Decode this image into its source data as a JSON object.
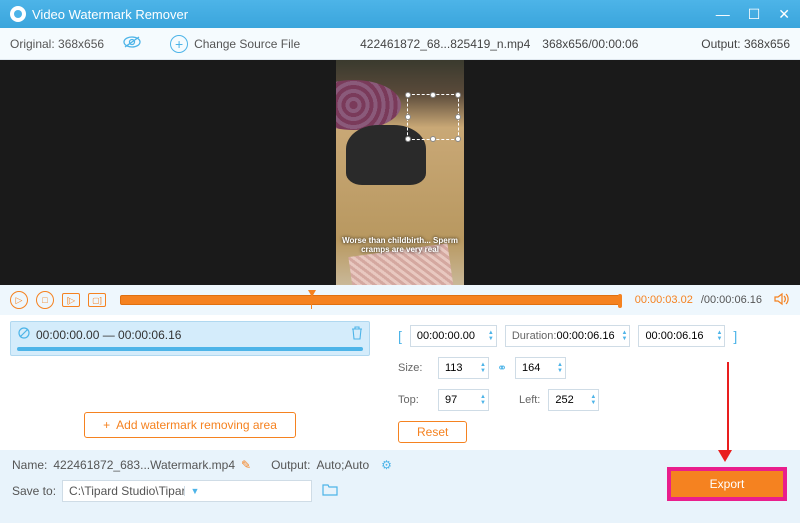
{
  "title": "Video Watermark Remover",
  "subbar": {
    "original": "Original: 368x656",
    "change_source": "Change Source File",
    "filename": "422461872_68...825419_n.mp4",
    "dims": "368x656/00:00:06",
    "output": "Output: 368x656"
  },
  "video_caption": "Worse than childbirth... Sperm cramps are very real",
  "timeline": {
    "current": "00:00:03.02",
    "total": "/00:00:06.16"
  },
  "clip": {
    "range": "00:00:00.00 — 00:00:06.16"
  },
  "add_area": "Add watermark removing area",
  "params": {
    "start": "00:00:00.00",
    "duration_label": "Duration:",
    "duration": "00:00:06.16",
    "end": "00:00:06.16",
    "size_label": "Size:",
    "w": "113",
    "h": "164",
    "top_label": "Top:",
    "top": "97",
    "left_label": "Left:",
    "left": "252",
    "reset": "Reset"
  },
  "bottom": {
    "name_label": "Name:",
    "name": "422461872_683...Watermark.mp4",
    "output_label": "Output:",
    "output": "Auto;Auto",
    "save_label": "Save to:",
    "save_path": "C:\\Tipard Studio\\Tipar...ideo Watermark Remover",
    "export": "Export"
  }
}
